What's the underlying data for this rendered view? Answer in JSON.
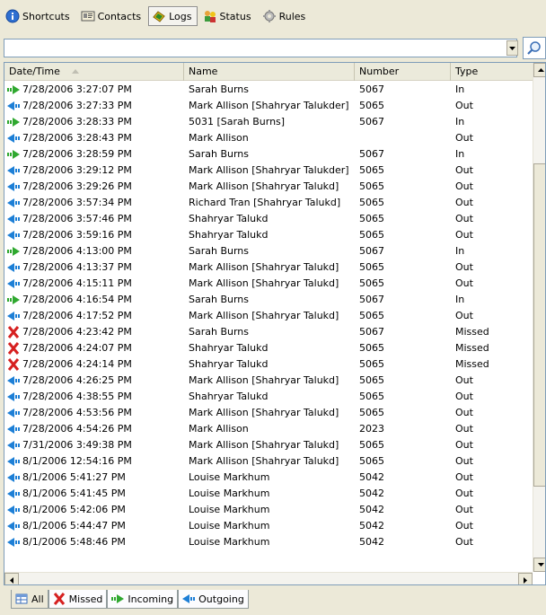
{
  "toolbar": {
    "tabs": [
      {
        "label": "Shortcuts",
        "icon": "info-globe-icon"
      },
      {
        "label": "Contacts",
        "icon": "contact-card-icon"
      },
      {
        "label": "Logs",
        "icon": "phone-log-icon",
        "active": true
      },
      {
        "label": "Status",
        "icon": "status-people-icon"
      },
      {
        "label": "Rules",
        "icon": "rules-gear-icon"
      }
    ]
  },
  "filter": {
    "value": "",
    "placeholder": ""
  },
  "columns": {
    "datetime": "Date/Time",
    "name": "Name",
    "number": "Number",
    "type": "Type"
  },
  "rows": [
    {
      "dir": "in",
      "datetime": "7/28/2006 3:27:07 PM",
      "name": "Sarah Burns",
      "number": "5067",
      "type": "In"
    },
    {
      "dir": "out",
      "datetime": "7/28/2006 3:27:33 PM",
      "name": "Mark Allison [Shahryar Talukder]",
      "number": "5065",
      "type": "Out"
    },
    {
      "dir": "in",
      "datetime": "7/28/2006 3:28:33 PM",
      "name": "5031 [Sarah Burns]",
      "number": "5067",
      "type": "In"
    },
    {
      "dir": "out",
      "datetime": "7/28/2006 3:28:43 PM",
      "name": "Mark Allison",
      "number": "",
      "type": "Out"
    },
    {
      "dir": "in",
      "datetime": "7/28/2006 3:28:59 PM",
      "name": "Sarah Burns",
      "number": "5067",
      "type": "In"
    },
    {
      "dir": "out",
      "datetime": "7/28/2006 3:29:12 PM",
      "name": "Mark Allison [Shahryar Talukder]",
      "number": "5065",
      "type": "Out"
    },
    {
      "dir": "out",
      "datetime": "7/28/2006 3:29:26 PM",
      "name": "Mark Allison [Shahryar Talukd]",
      "number": "5065",
      "type": "Out"
    },
    {
      "dir": "out",
      "datetime": "7/28/2006 3:57:34 PM",
      "name": "Richard Tran [Shahryar Talukd]",
      "number": "5065",
      "type": "Out"
    },
    {
      "dir": "out",
      "datetime": "7/28/2006 3:57:46 PM",
      "name": "Shahryar Talukd",
      "number": "5065",
      "type": "Out"
    },
    {
      "dir": "out",
      "datetime": "7/28/2006 3:59:16 PM",
      "name": "Shahryar Talukd",
      "number": "5065",
      "type": "Out"
    },
    {
      "dir": "in",
      "datetime": "7/28/2006 4:13:00 PM",
      "name": "Sarah Burns",
      "number": "5067",
      "type": "In"
    },
    {
      "dir": "out",
      "datetime": "7/28/2006 4:13:37 PM",
      "name": "Mark Allison [Shahryar Talukd]",
      "number": "5065",
      "type": "Out"
    },
    {
      "dir": "out",
      "datetime": "7/28/2006 4:15:11 PM",
      "name": "Mark Allison [Shahryar Talukd]",
      "number": "5065",
      "type": "Out"
    },
    {
      "dir": "in",
      "datetime": "7/28/2006 4:16:54 PM",
      "name": "Sarah Burns",
      "number": "5067",
      "type": "In"
    },
    {
      "dir": "out",
      "datetime": "7/28/2006 4:17:52 PM",
      "name": "Mark Allison [Shahryar Talukd]",
      "number": "5065",
      "type": "Out"
    },
    {
      "dir": "missed",
      "datetime": "7/28/2006 4:23:42 PM",
      "name": "Sarah Burns",
      "number": "5067",
      "type": "Missed"
    },
    {
      "dir": "missed",
      "datetime": "7/28/2006 4:24:07 PM",
      "name": "Shahryar Talukd",
      "number": "5065",
      "type": "Missed"
    },
    {
      "dir": "missed",
      "datetime": "7/28/2006 4:24:14 PM",
      "name": "Shahryar Talukd",
      "number": "5065",
      "type": "Missed"
    },
    {
      "dir": "out",
      "datetime": "7/28/2006 4:26:25 PM",
      "name": "Mark Allison [Shahryar Talukd]",
      "number": "5065",
      "type": "Out"
    },
    {
      "dir": "out",
      "datetime": "7/28/2006 4:38:55 PM",
      "name": "Shahryar Talukd",
      "number": "5065",
      "type": "Out"
    },
    {
      "dir": "out",
      "datetime": "7/28/2006 4:53:56 PM",
      "name": "Mark Allison [Shahryar Talukd]",
      "number": "5065",
      "type": "Out"
    },
    {
      "dir": "out",
      "datetime": "7/28/2006 4:54:26 PM",
      "name": "Mark Allison",
      "number": "2023",
      "type": "Out"
    },
    {
      "dir": "out",
      "datetime": "7/31/2006 3:49:38 PM",
      "name": "Mark Allison [Shahryar Talukd]",
      "number": "5065",
      "type": "Out"
    },
    {
      "dir": "out",
      "datetime": "8/1/2006 12:54:16 PM",
      "name": "Mark Allison [Shahryar Talukd]",
      "number": "5065",
      "type": "Out"
    },
    {
      "dir": "out",
      "datetime": "8/1/2006 5:41:27 PM",
      "name": "Louise Markhum",
      "number": "5042",
      "type": "Out"
    },
    {
      "dir": "out",
      "datetime": "8/1/2006 5:41:45 PM",
      "name": "Louise Markhum",
      "number": "5042",
      "type": "Out"
    },
    {
      "dir": "out",
      "datetime": "8/1/2006 5:42:06 PM",
      "name": "Louise Markhum",
      "number": "5042",
      "type": "Out"
    },
    {
      "dir": "out",
      "datetime": "8/1/2006 5:44:47 PM",
      "name": "Louise Markhum",
      "number": "5042",
      "type": "Out"
    },
    {
      "dir": "out",
      "datetime": "8/1/2006 5:48:46 PM",
      "name": "Louise Markhum",
      "number": "5042",
      "type": "Out"
    }
  ],
  "bottom_tabs": [
    {
      "label": "All",
      "icon": "grid-all-icon"
    },
    {
      "label": "Missed",
      "icon": "missed-x-icon"
    },
    {
      "label": "Incoming",
      "icon": "incoming-arrow-icon"
    },
    {
      "label": "Outgoing",
      "icon": "outgoing-arrow-icon"
    }
  ],
  "colors": {
    "in_arrow": "#2fa82f",
    "out_arrow": "#1d7fd6",
    "missed_x": "#d62020"
  }
}
